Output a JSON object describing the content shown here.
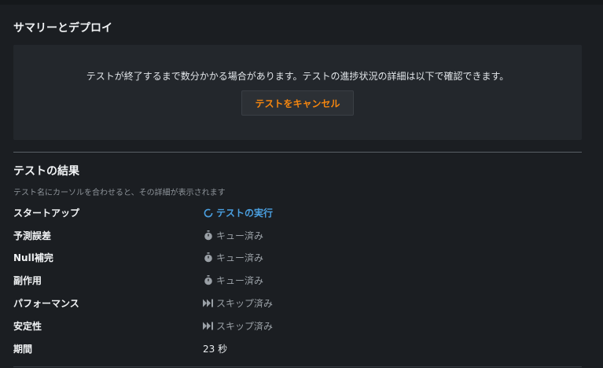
{
  "summary": {
    "title": "サマリーとデプロイ",
    "notice_text": "テストが終了するまで数分かかる場合があります。テストの進捗状況の詳細は以下で確認できます。",
    "cancel_label": "テストをキャンセル"
  },
  "results": {
    "title": "テストの結果",
    "hint": "テスト名にカーソルを合わせると、その詳細が表示されます",
    "rows": [
      {
        "label": "スタートアップ",
        "status": "テストの実行",
        "icon": "spinner-icon"
      },
      {
        "label": "予測誤差",
        "status": "キュー済み",
        "icon": "stopwatch-icon"
      },
      {
        "label": "Null補完",
        "status": "キュー済み",
        "icon": "stopwatch-icon"
      },
      {
        "label": "副作用",
        "status": "キュー済み",
        "icon": "stopwatch-icon"
      },
      {
        "label": "パフォーマンス",
        "status": "スキップ済み",
        "icon": "skip-forward-icon"
      },
      {
        "label": "安定性",
        "status": "スキップ済み",
        "icon": "skip-forward-icon"
      },
      {
        "label": "期間",
        "status": "23 秒"
      }
    ]
  },
  "colors": {
    "accent_orange": "#f5860f",
    "running_blue": "#4a9fe0",
    "background": "#1b1e22",
    "panel": "#23272c"
  }
}
